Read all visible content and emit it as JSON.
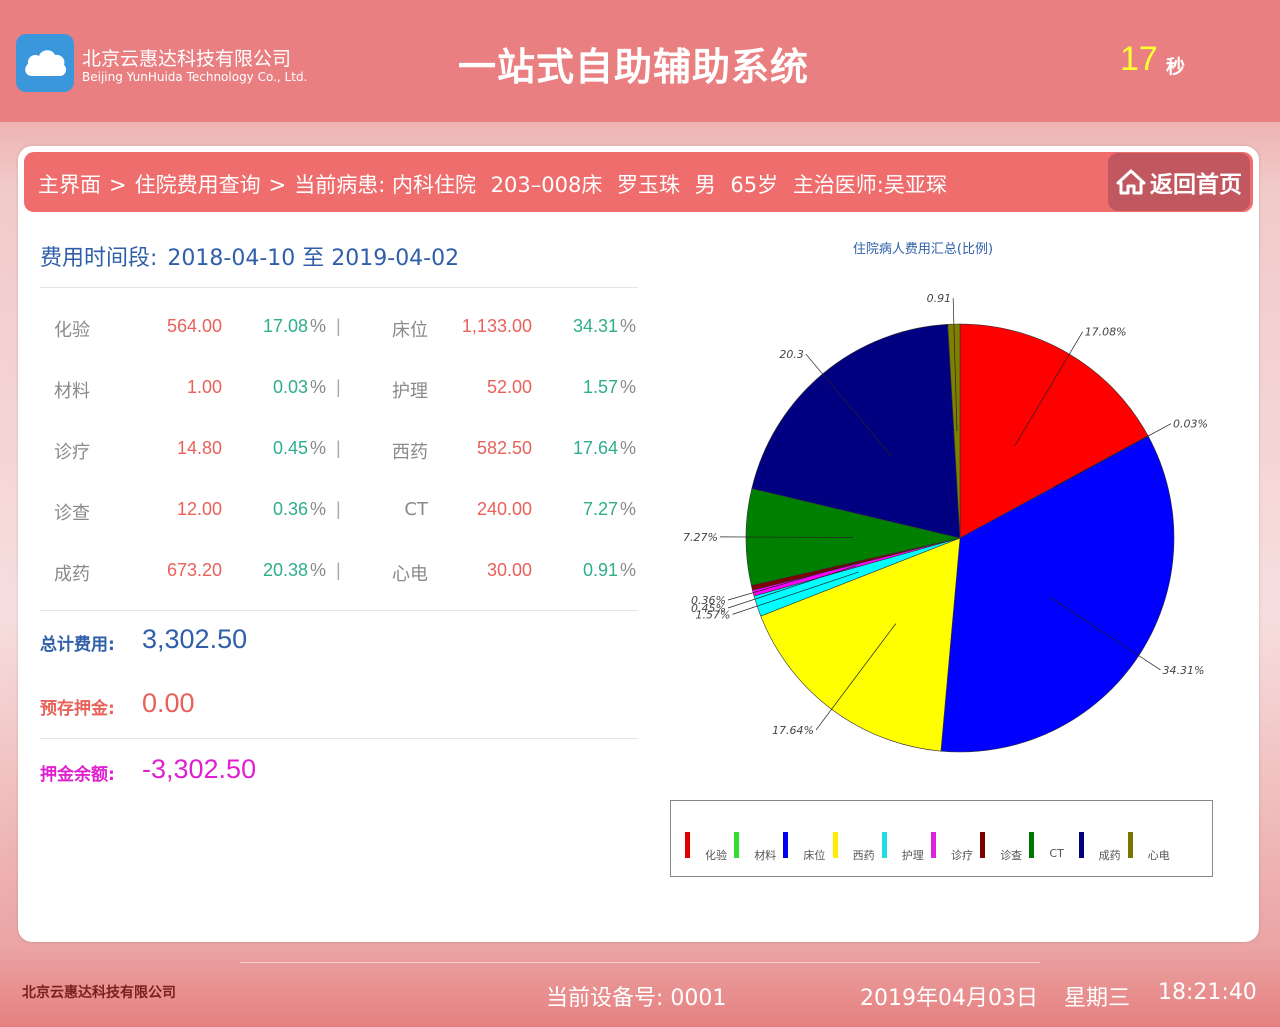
{
  "header": {
    "company_cn": "北京云惠达科技有限公司",
    "company_en": "Beijing YunHuida Technology Co., Ltd.",
    "title": "一站式自助辅助系统",
    "countdown": "17",
    "countdown_unit": "秒"
  },
  "breadcrumb": {
    "home": "主界面",
    "sep1": ">",
    "page": "住院费用查询",
    "sep2": ">",
    "patient_label": "当前病患: 内科住院",
    "bed": "203–008床",
    "name": "罗玉珠",
    "gender": "男",
    "age": "65岁",
    "doctor": "主治医师:吴亚琛"
  },
  "home_button": {
    "label": "返回首页",
    "icon": "home-icon"
  },
  "period": {
    "label": "费用时间段:",
    "value": "2018-04-10 至 2019-04-02"
  },
  "fees": [
    {
      "left": {
        "name": "化验",
        "amount": "564.00",
        "pct": "17.08"
      },
      "right": {
        "name": "床位",
        "amount": "1,133.00",
        "pct": "34.31"
      }
    },
    {
      "left": {
        "name": "材料",
        "amount": "1.00",
        "pct": "0.03"
      },
      "right": {
        "name": "护理",
        "amount": "52.00",
        "pct": "1.57"
      }
    },
    {
      "left": {
        "name": "诊疗",
        "amount": "14.80",
        "pct": "0.45"
      },
      "right": {
        "name": "西药",
        "amount": "582.50",
        "pct": "17.64"
      }
    },
    {
      "left": {
        "name": "诊查",
        "amount": "12.00",
        "pct": "0.36"
      },
      "right": {
        "name": "CT",
        "amount": "240.00",
        "pct": "7.27"
      }
    },
    {
      "left": {
        "name": "成药",
        "amount": "673.20",
        "pct": "20.38"
      },
      "right": {
        "name": "心电",
        "amount": "30.00",
        "pct": "0.91"
      }
    }
  ],
  "pct_sign": "%",
  "separator": "|",
  "summary": {
    "total_label": "总计费用:",
    "total_value": "3,302.50",
    "deposit_label": "预存押金:",
    "deposit_value": "0.00",
    "balance_label": "押金余额:",
    "balance_value": "-3,302.50"
  },
  "colors": {
    "total": "#2f5fa8",
    "deposit": "#e8615a",
    "balance": "#e020d0"
  },
  "chart_data": {
    "type": "pie",
    "title": "住院病人费用汇总(比例)",
    "slices": [
      {
        "name": "化验",
        "value": 17.08,
        "label": "17.08%",
        "color": "#ff0000"
      },
      {
        "name": "材料",
        "value": 0.03,
        "label": "0.03%",
        "color": "#00ff00"
      },
      {
        "name": "床位",
        "value": 34.31,
        "label": "34.31%",
        "color": "#0000ff"
      },
      {
        "name": "西药",
        "value": 17.64,
        "label": "17.64%",
        "color": "#ffff00"
      },
      {
        "name": "护理",
        "value": 1.57,
        "label": "1.57%",
        "color": "#00ffff"
      },
      {
        "name": "诊疗",
        "value": 0.45,
        "label": "0.45%",
        "color": "#ff00ff"
      },
      {
        "name": "诊查",
        "value": 0.36,
        "label": "0.36%",
        "color": "#800000"
      },
      {
        "name": "CT",
        "value": 7.27,
        "label": "7.27%",
        "color": "#008000"
      },
      {
        "name": "成药",
        "value": 20.38,
        "label": "20.3",
        "color": "#000080"
      },
      {
        "name": "心电",
        "value": 0.91,
        "label": "0.91",
        "color": "#808000"
      }
    ],
    "legend": [
      {
        "name": "化验",
        "color": "#dd0000"
      },
      {
        "name": "材料",
        "color": "#33dd33"
      },
      {
        "name": "床位",
        "color": "#0000ee"
      },
      {
        "name": "西药",
        "color": "#ffee00"
      },
      {
        "name": "护理",
        "color": "#22dddd"
      },
      {
        "name": "诊疗",
        "color": "#dd22dd"
      },
      {
        "name": "诊查",
        "color": "#770000"
      },
      {
        "name": "CT",
        "color": "#007700"
      },
      {
        "name": "成药",
        "color": "#000077"
      },
      {
        "name": "心电",
        "color": "#777700"
      }
    ],
    "legend_position": "bottom"
  },
  "footer": {
    "company": "北京云惠达科技有限公司",
    "device": "当前设备号: 0001",
    "date": "2019年04月03日",
    "weekday": "星期三",
    "time": "18:21:40"
  }
}
